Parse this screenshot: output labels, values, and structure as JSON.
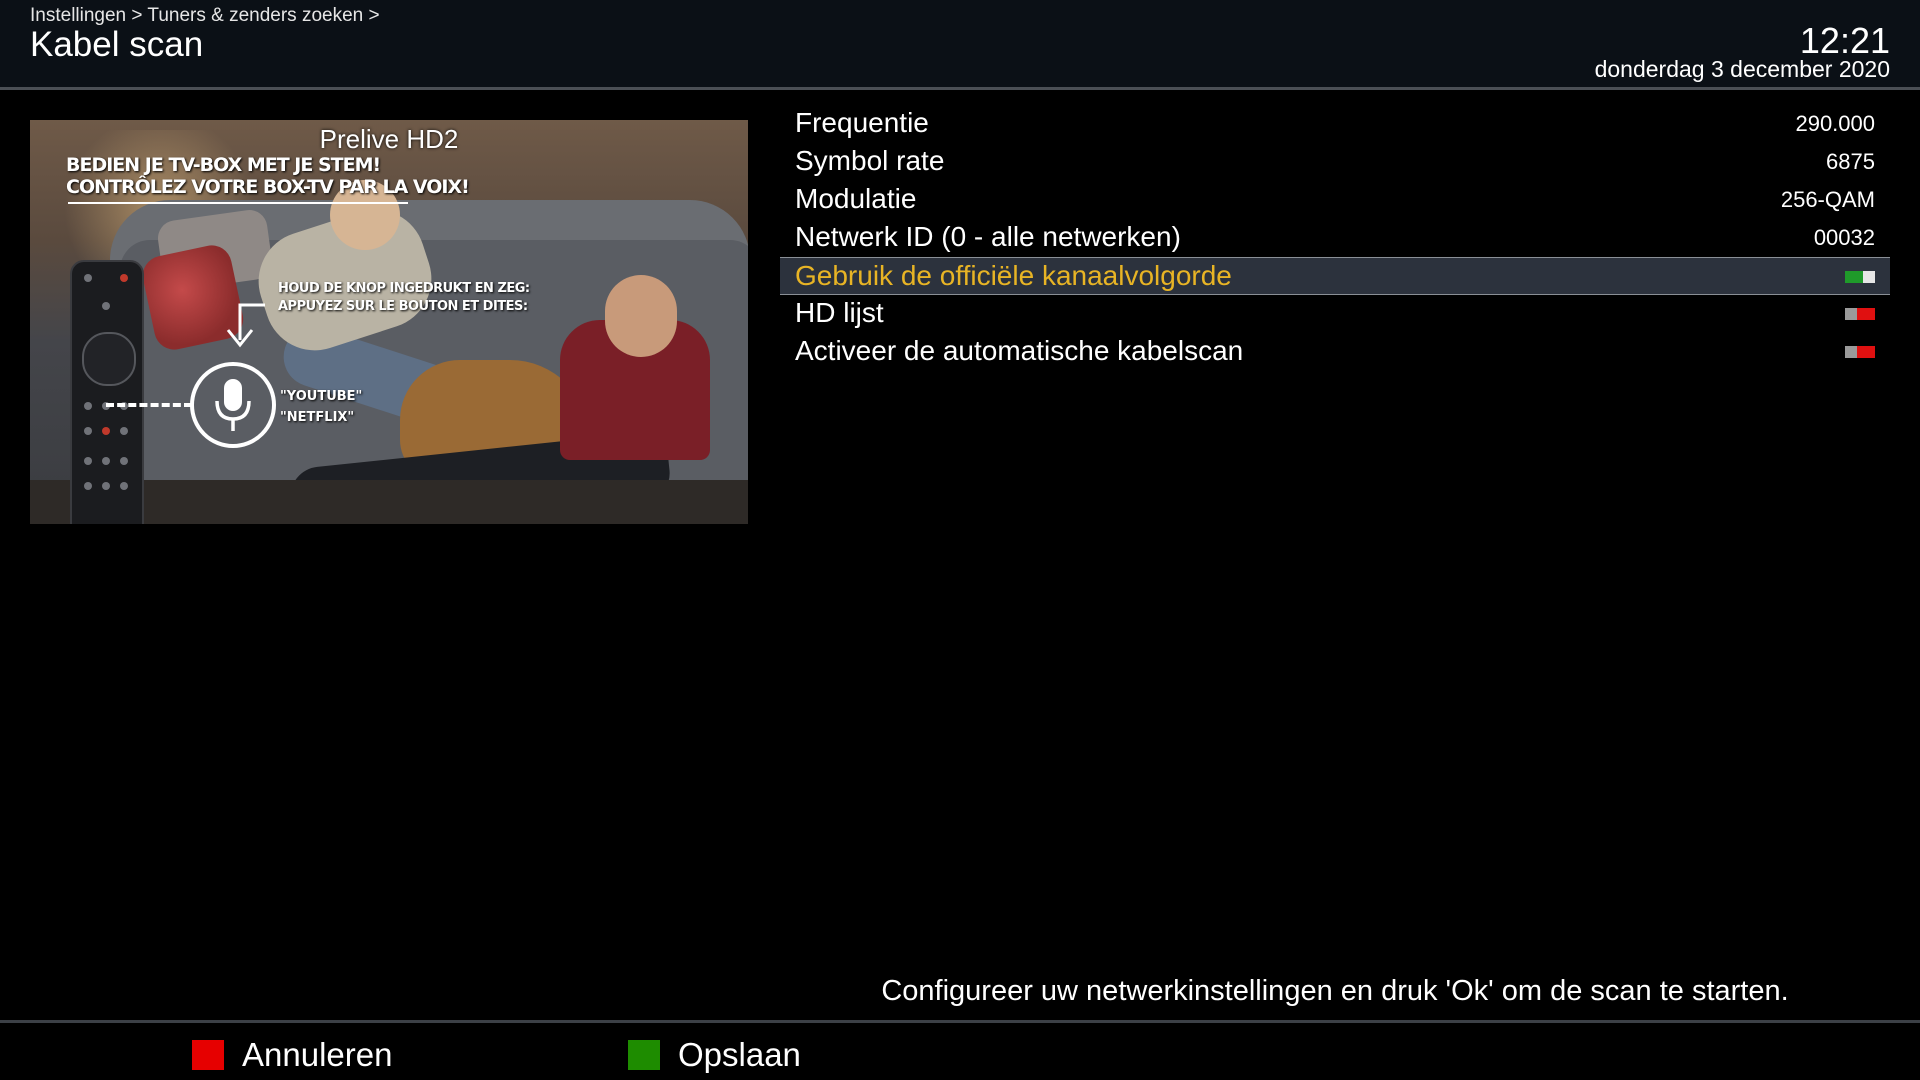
{
  "header": {
    "breadcrumb": "Instellingen > Tuners & zenders zoeken >",
    "title": "Kabel scan",
    "time": "12:21",
    "date": "donderdag 3 december 2020"
  },
  "preview": {
    "channel_name": "Prelive HD2",
    "promo_line1": "BEDIEN JE TV-BOX MET JE STEM!",
    "promo_line2": "CONTRÔLEZ VOTRE BOX-TV PAR LA VOIX!",
    "hint_line1": "HOUD DE KNOP INGEDRUKT EN ZEG:",
    "hint_line2": "APPUYEZ SUR LE BOUTON ET DITES:",
    "voice_cmd1": "\"YOUTUBE\"",
    "voice_cmd2": "\"NETFLIX\""
  },
  "settings": {
    "items": [
      {
        "label": "Frequentie",
        "value": "290.000"
      },
      {
        "label": "Symbol rate",
        "value": "6875"
      },
      {
        "label": "Modulatie",
        "value": "256-QAM"
      },
      {
        "label": "Netwerk ID (0 - alle netwerken)",
        "value": "00032"
      },
      {
        "label": "Gebruik de officiële kanaalvolgorde",
        "toggle": "on",
        "selected": true
      },
      {
        "label": "HD lijst",
        "toggle": "off"
      },
      {
        "label": "Activeer de automatische kabelscan",
        "toggle": "off"
      }
    ]
  },
  "help_text": "Configureer uw netwerkinstellingen en druk 'Ok' om de scan te starten.",
  "footer": {
    "cancel_label": "Annuleren",
    "save_label": "Opslaan",
    "cancel_color": "#e60000",
    "save_color": "#1e8c00"
  },
  "colors": {
    "selected_label": "#e8b425",
    "selected_row_bg": "#2c323d",
    "toggle_on": "#1f9a2a",
    "toggle_off": "#e01010"
  },
  "icons": {
    "toggle_on": "toggle-on-icon",
    "toggle_off": "toggle-off-icon",
    "microphone": "microphone-icon",
    "remote": "remote-control-icon"
  }
}
